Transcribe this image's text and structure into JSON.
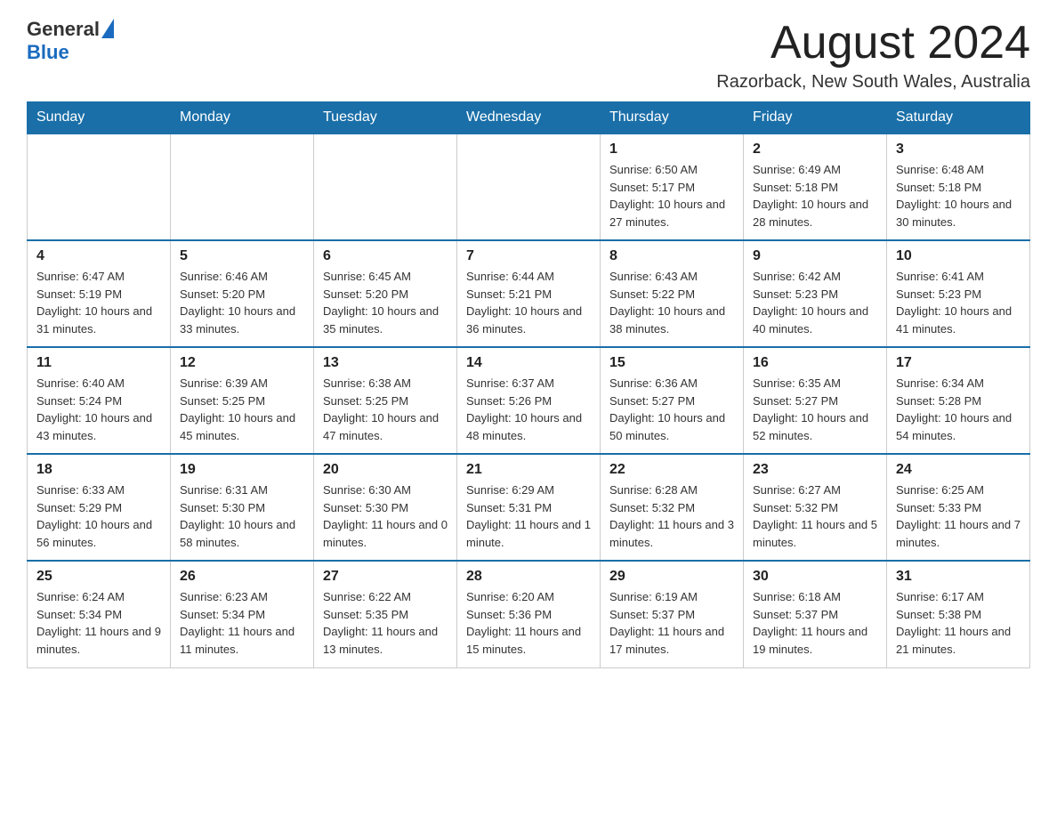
{
  "header": {
    "logo_general": "General",
    "logo_blue": "Blue",
    "month_title": "August 2024",
    "location": "Razorback, New South Wales, Australia"
  },
  "weekdays": [
    "Sunday",
    "Monday",
    "Tuesday",
    "Wednesday",
    "Thursday",
    "Friday",
    "Saturday"
  ],
  "weeks": [
    [
      {
        "day": "",
        "sunrise": "",
        "sunset": "",
        "daylight": ""
      },
      {
        "day": "",
        "sunrise": "",
        "sunset": "",
        "daylight": ""
      },
      {
        "day": "",
        "sunrise": "",
        "sunset": "",
        "daylight": ""
      },
      {
        "day": "",
        "sunrise": "",
        "sunset": "",
        "daylight": ""
      },
      {
        "day": "1",
        "sunrise": "Sunrise: 6:50 AM",
        "sunset": "Sunset: 5:17 PM",
        "daylight": "Daylight: 10 hours and 27 minutes."
      },
      {
        "day": "2",
        "sunrise": "Sunrise: 6:49 AM",
        "sunset": "Sunset: 5:18 PM",
        "daylight": "Daylight: 10 hours and 28 minutes."
      },
      {
        "day": "3",
        "sunrise": "Sunrise: 6:48 AM",
        "sunset": "Sunset: 5:18 PM",
        "daylight": "Daylight: 10 hours and 30 minutes."
      }
    ],
    [
      {
        "day": "4",
        "sunrise": "Sunrise: 6:47 AM",
        "sunset": "Sunset: 5:19 PM",
        "daylight": "Daylight: 10 hours and 31 minutes."
      },
      {
        "day": "5",
        "sunrise": "Sunrise: 6:46 AM",
        "sunset": "Sunset: 5:20 PM",
        "daylight": "Daylight: 10 hours and 33 minutes."
      },
      {
        "day": "6",
        "sunrise": "Sunrise: 6:45 AM",
        "sunset": "Sunset: 5:20 PM",
        "daylight": "Daylight: 10 hours and 35 minutes."
      },
      {
        "day": "7",
        "sunrise": "Sunrise: 6:44 AM",
        "sunset": "Sunset: 5:21 PM",
        "daylight": "Daylight: 10 hours and 36 minutes."
      },
      {
        "day": "8",
        "sunrise": "Sunrise: 6:43 AM",
        "sunset": "Sunset: 5:22 PM",
        "daylight": "Daylight: 10 hours and 38 minutes."
      },
      {
        "day": "9",
        "sunrise": "Sunrise: 6:42 AM",
        "sunset": "Sunset: 5:23 PM",
        "daylight": "Daylight: 10 hours and 40 minutes."
      },
      {
        "day": "10",
        "sunrise": "Sunrise: 6:41 AM",
        "sunset": "Sunset: 5:23 PM",
        "daylight": "Daylight: 10 hours and 41 minutes."
      }
    ],
    [
      {
        "day": "11",
        "sunrise": "Sunrise: 6:40 AM",
        "sunset": "Sunset: 5:24 PM",
        "daylight": "Daylight: 10 hours and 43 minutes."
      },
      {
        "day": "12",
        "sunrise": "Sunrise: 6:39 AM",
        "sunset": "Sunset: 5:25 PM",
        "daylight": "Daylight: 10 hours and 45 minutes."
      },
      {
        "day": "13",
        "sunrise": "Sunrise: 6:38 AM",
        "sunset": "Sunset: 5:25 PM",
        "daylight": "Daylight: 10 hours and 47 minutes."
      },
      {
        "day": "14",
        "sunrise": "Sunrise: 6:37 AM",
        "sunset": "Sunset: 5:26 PM",
        "daylight": "Daylight: 10 hours and 48 minutes."
      },
      {
        "day": "15",
        "sunrise": "Sunrise: 6:36 AM",
        "sunset": "Sunset: 5:27 PM",
        "daylight": "Daylight: 10 hours and 50 minutes."
      },
      {
        "day": "16",
        "sunrise": "Sunrise: 6:35 AM",
        "sunset": "Sunset: 5:27 PM",
        "daylight": "Daylight: 10 hours and 52 minutes."
      },
      {
        "day": "17",
        "sunrise": "Sunrise: 6:34 AM",
        "sunset": "Sunset: 5:28 PM",
        "daylight": "Daylight: 10 hours and 54 minutes."
      }
    ],
    [
      {
        "day": "18",
        "sunrise": "Sunrise: 6:33 AM",
        "sunset": "Sunset: 5:29 PM",
        "daylight": "Daylight: 10 hours and 56 minutes."
      },
      {
        "day": "19",
        "sunrise": "Sunrise: 6:31 AM",
        "sunset": "Sunset: 5:30 PM",
        "daylight": "Daylight: 10 hours and 58 minutes."
      },
      {
        "day": "20",
        "sunrise": "Sunrise: 6:30 AM",
        "sunset": "Sunset: 5:30 PM",
        "daylight": "Daylight: 11 hours and 0 minutes."
      },
      {
        "day": "21",
        "sunrise": "Sunrise: 6:29 AM",
        "sunset": "Sunset: 5:31 PM",
        "daylight": "Daylight: 11 hours and 1 minute."
      },
      {
        "day": "22",
        "sunrise": "Sunrise: 6:28 AM",
        "sunset": "Sunset: 5:32 PM",
        "daylight": "Daylight: 11 hours and 3 minutes."
      },
      {
        "day": "23",
        "sunrise": "Sunrise: 6:27 AM",
        "sunset": "Sunset: 5:32 PM",
        "daylight": "Daylight: 11 hours and 5 minutes."
      },
      {
        "day": "24",
        "sunrise": "Sunrise: 6:25 AM",
        "sunset": "Sunset: 5:33 PM",
        "daylight": "Daylight: 11 hours and 7 minutes."
      }
    ],
    [
      {
        "day": "25",
        "sunrise": "Sunrise: 6:24 AM",
        "sunset": "Sunset: 5:34 PM",
        "daylight": "Daylight: 11 hours and 9 minutes."
      },
      {
        "day": "26",
        "sunrise": "Sunrise: 6:23 AM",
        "sunset": "Sunset: 5:34 PM",
        "daylight": "Daylight: 11 hours and 11 minutes."
      },
      {
        "day": "27",
        "sunrise": "Sunrise: 6:22 AM",
        "sunset": "Sunset: 5:35 PM",
        "daylight": "Daylight: 11 hours and 13 minutes."
      },
      {
        "day": "28",
        "sunrise": "Sunrise: 6:20 AM",
        "sunset": "Sunset: 5:36 PM",
        "daylight": "Daylight: 11 hours and 15 minutes."
      },
      {
        "day": "29",
        "sunrise": "Sunrise: 6:19 AM",
        "sunset": "Sunset: 5:37 PM",
        "daylight": "Daylight: 11 hours and 17 minutes."
      },
      {
        "day": "30",
        "sunrise": "Sunrise: 6:18 AM",
        "sunset": "Sunset: 5:37 PM",
        "daylight": "Daylight: 11 hours and 19 minutes."
      },
      {
        "day": "31",
        "sunrise": "Sunrise: 6:17 AM",
        "sunset": "Sunset: 5:38 PM",
        "daylight": "Daylight: 11 hours and 21 minutes."
      }
    ]
  ]
}
